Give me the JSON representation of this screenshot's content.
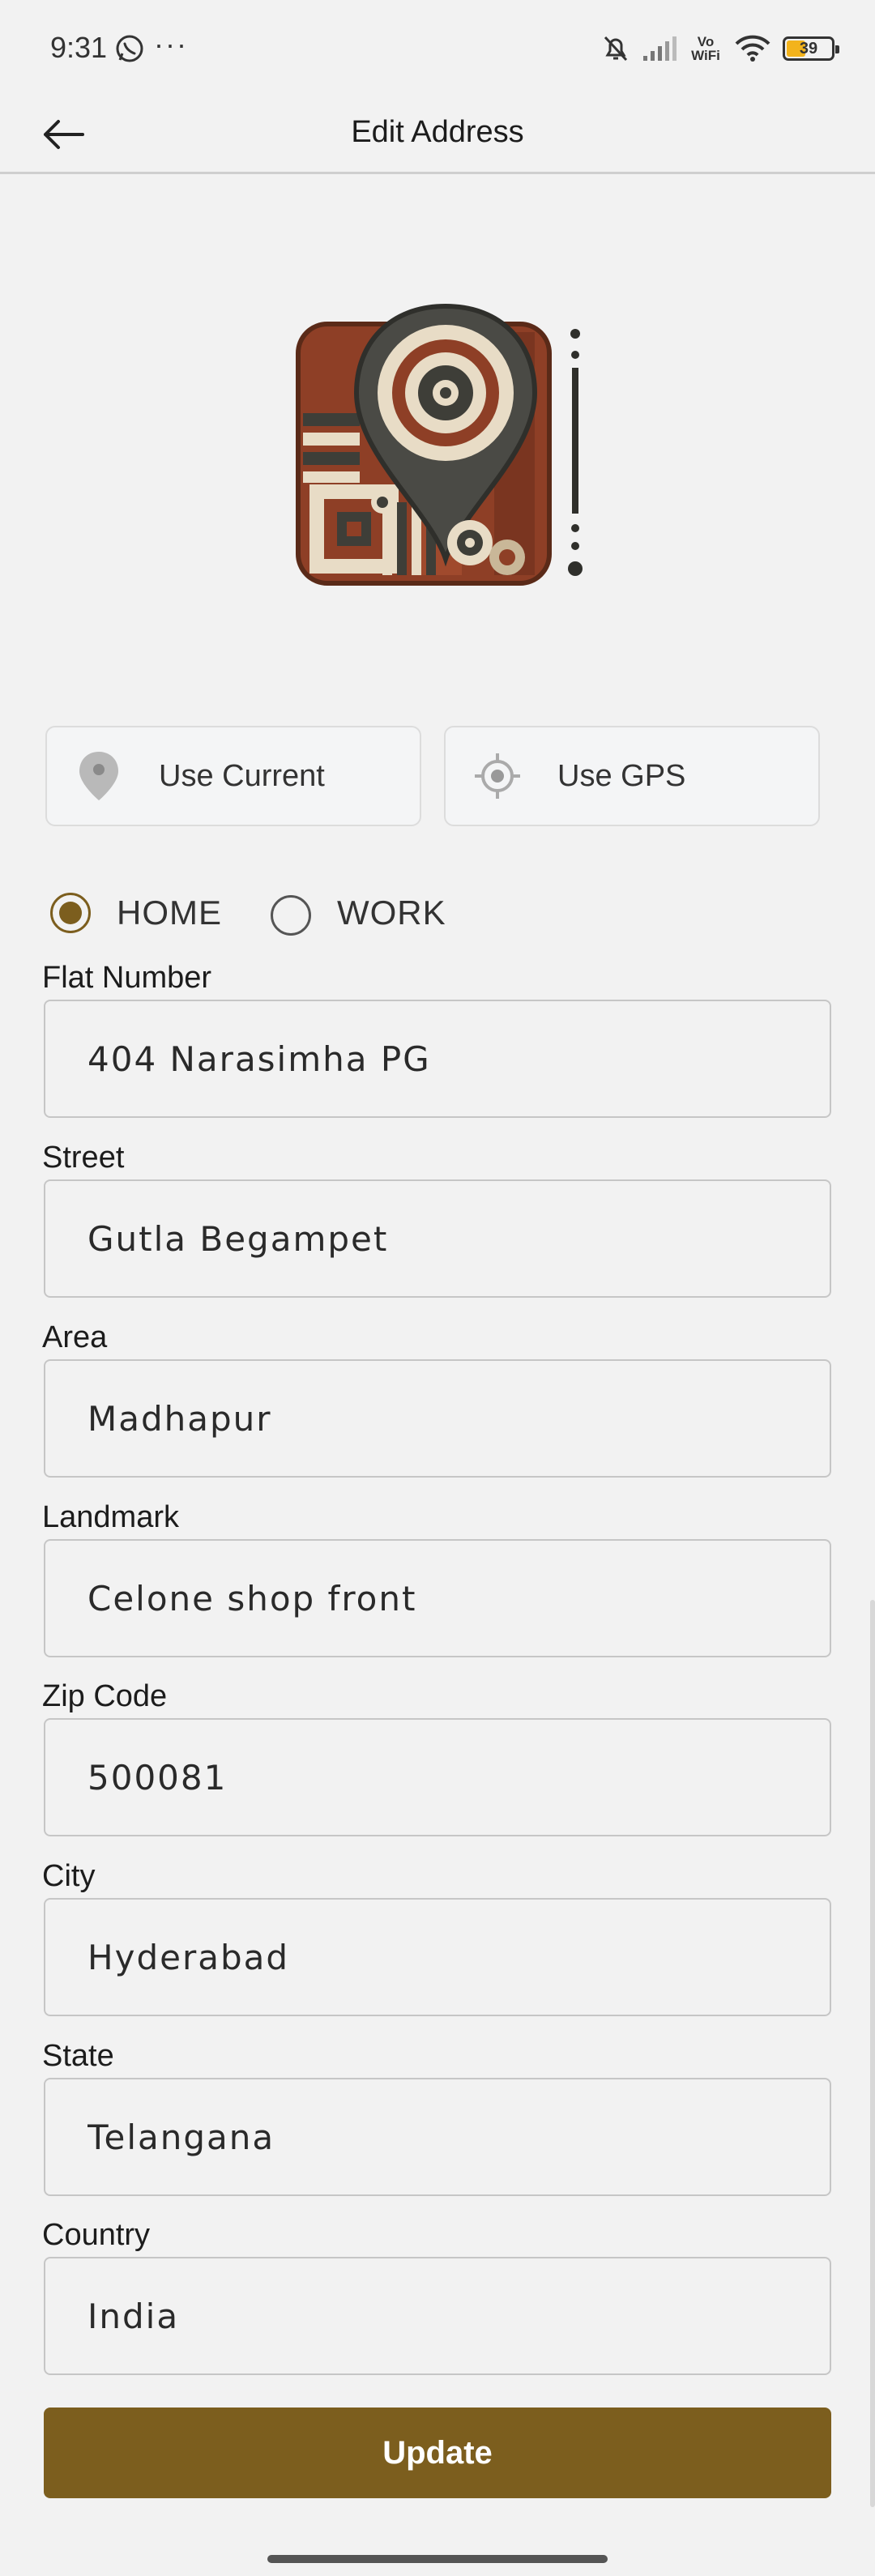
{
  "status_bar": {
    "time": "9:31",
    "more": "···",
    "network": "Vo WiFi",
    "battery": "39",
    "icons": [
      "whatsapp-icon",
      "mute-bell-icon",
      "signal-icon",
      "wifi-icon",
      "battery-icon"
    ]
  },
  "app_bar": {
    "title": "Edit Address",
    "back_icon": "arrow-left-icon"
  },
  "logo": {
    "icon": "map-pin-logo"
  },
  "location_buttons": [
    {
      "label": "Use Current",
      "icon": "map-marker-icon"
    },
    {
      "label": "Use GPS",
      "icon": "gps-target-icon"
    }
  ],
  "address_type": {
    "options": [
      {
        "label": "HOME",
        "selected": true
      },
      {
        "label": "WORK",
        "selected": false
      }
    ]
  },
  "fields": [
    {
      "label": "Flat Number",
      "value": "404 Narasimha PG"
    },
    {
      "label": "Street",
      "value": "Gutla Begampet"
    },
    {
      "label": "Area",
      "value": "Madhapur"
    },
    {
      "label": "Landmark",
      "value": "Celone shop front"
    },
    {
      "label": "Zip Code",
      "value": "500081"
    },
    {
      "label": "City",
      "value": "Hyderabad"
    },
    {
      "label": "State",
      "value": "Telangana"
    },
    {
      "label": "Country",
      "value": "India"
    }
  ],
  "submit": {
    "label": "Update"
  },
  "colors": {
    "accent": "#7c5e1e",
    "background": "#f2f2f2",
    "button_bg": "#f4f5f6"
  }
}
